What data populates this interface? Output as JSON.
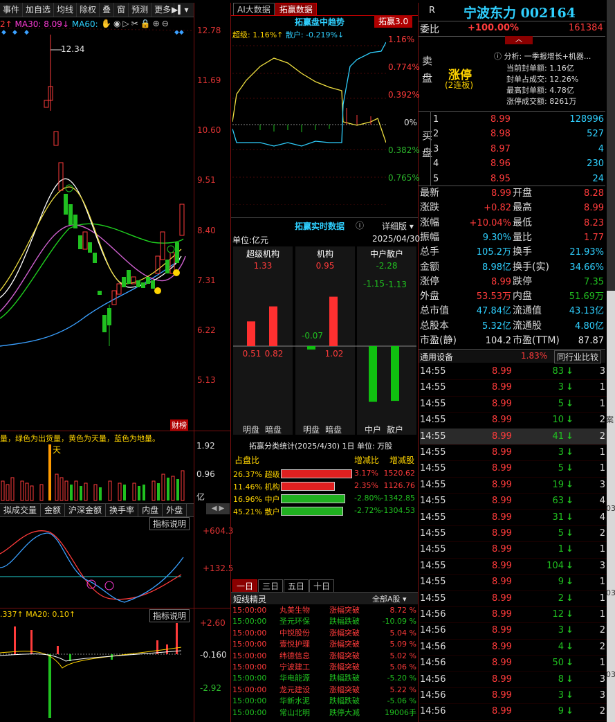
{
  "toolbar": {
    "items": [
      "事件",
      "加自选",
      "均线",
      "除权",
      "叠",
      "窗",
      "预测",
      "更多"
    ]
  },
  "left_chart": {
    "ma_header": {
      "a": "2↑",
      "ma30": "MA30: 8.09↓",
      "ma60": "MA60:"
    },
    "price_axis": [
      "12.78",
      "11.69",
      "10.60",
      "9.51",
      "8.40",
      "7.31",
      "6.22",
      "5.13"
    ],
    "peak_label": "12.34",
    "badge": "财榜",
    "vol_legend": "量，绿色为出货量，黄色为天量，蓝色为地量。",
    "vol_axis": [
      "1.92",
      "0.96",
      "亿"
    ],
    "vol_mark": "天",
    "tabs": [
      "拟成交量",
      "金额",
      "沪深金额",
      "换手率",
      "内盘",
      "外盘"
    ],
    "ind1": {
      "btn": "指标说明",
      "axis": [
        "+604.3",
        "+132.5"
      ]
    },
    "ind2": {
      "header": ".337↑  MA20: 0.10↑",
      "btn": "指标说明",
      "axis": [
        "+2.60",
        "-0.160",
        "-2.92"
      ]
    }
  },
  "mid": {
    "tabs": [
      "AI大数据",
      "拓赢数据"
    ],
    "trend_title": "拓赢盘中趋势",
    "trend_badge": "拓赢3.0",
    "trend_legend": {
      "super": "超级: 1.16%↑",
      "retail": "散户: -0.219%↓"
    },
    "trend_axis": [
      "1.16%",
      "0.774%",
      "0.392%",
      "0%",
      "0.382%",
      "0.765%"
    ],
    "realtime_title": "拓赢实时数据",
    "detail_btn": "详细版",
    "unit": "单位:亿元",
    "date": "2025/04/30",
    "cols": [
      "超级机构",
      "机构",
      "中户散户"
    ],
    "col_totals": [
      "1.33",
      "0.95",
      "-2.28"
    ],
    "bar_labels": [
      "明盘",
      "暗盘",
      "明盘",
      "暗盘",
      "中户",
      "散户"
    ],
    "bar_values": [
      "0.51",
      "0.82",
      "-0.07",
      "1.02",
      "-1.15",
      "-1.13"
    ],
    "classify_title": "拓赢分类统计(2025/4/30) 1日  单位: 万股",
    "classify_head": {
      "pct": "占盘比",
      "chg": "增减比",
      "shares": "增减股"
    },
    "classify_rows": [
      {
        "pct": "26.37% 超级",
        "chg": "3.17%",
        "shares": "1520.62",
        "color": "#e02020"
      },
      {
        "pct": "11.46% 机构",
        "chg": "2.35%",
        "shares": "1126.76",
        "color": "#e02020"
      },
      {
        "pct": "16.96% 中户",
        "chg": "-2.80%",
        "shares": "-1342.85",
        "color": "#20b020"
      },
      {
        "pct": "45.21% 散户",
        "chg": "-2.72%",
        "shares": "-1304.53",
        "color": "#20b020"
      }
    ],
    "period_tabs": [
      "一日",
      "三日",
      "五日",
      "十日"
    ],
    "sprite_title": "短线精灵",
    "sprite_filter": "全部A股",
    "sprite_rows": [
      {
        "t": "15:00:00",
        "name": "丸美生物",
        "type": "涨幅突破",
        "val": "8.72 %",
        "up": true
      },
      {
        "t": "15:00:00",
        "name": "圣元环保",
        "type": "跌幅跌破",
        "val": "-10.09 %",
        "up": false
      },
      {
        "t": "15:00:00",
        "name": "中锐股份",
        "type": "涨幅突破",
        "val": "5.04 %",
        "up": true
      },
      {
        "t": "15:00:00",
        "name": "壹悦护理",
        "type": "涨幅突破",
        "val": "5.09 %",
        "up": true
      },
      {
        "t": "15:00:00",
        "name": "纬德信息",
        "type": "涨幅突破",
        "val": "5.02 %",
        "up": true
      },
      {
        "t": "15:00:00",
        "name": "宁波建工",
        "type": "涨幅突破",
        "val": "5.06 %",
        "up": true
      },
      {
        "t": "15:00:00",
        "name": "华电能源",
        "type": "跌幅跌破",
        "val": "-5.20 %",
        "up": false
      },
      {
        "t": "15:00:00",
        "name": "龙元建设",
        "type": "涨幅突破",
        "val": "5.22 %",
        "up": true
      },
      {
        "t": "15:00:00",
        "name": "华新水泥",
        "type": "跌幅跌破",
        "val": "-5.06 %",
        "up": false
      },
      {
        "t": "15:00:00",
        "name": "常山北明",
        "type": "跌停大减",
        "val": "19006手",
        "up": false
      }
    ]
  },
  "right": {
    "r_mark": "R",
    "stock_title": "宁波东力  002164",
    "weibi_label": "委比",
    "weibi_pct": "+100.00%",
    "weibi_val": "161384",
    "sell_label": "卖盘",
    "buy_label": "买盘",
    "limit_up": "涨停",
    "limit_sub": "(2连板)",
    "analysis": "分析: 一季报增长+机器...",
    "seal_info": [
      "当前封单额: 1.16亿",
      "封单占成交: 12.26%",
      "最高封单额: 4.78亿",
      "涨停成交额: 8261万"
    ],
    "bids": [
      {
        "n": "1",
        "p": "8.99",
        "v": "128996"
      },
      {
        "n": "2",
        "p": "8.98",
        "v": "527"
      },
      {
        "n": "3",
        "p": "8.97",
        "v": "4"
      },
      {
        "n": "4",
        "p": "8.96",
        "v": "230"
      },
      {
        "n": "5",
        "p": "8.95",
        "v": "24"
      }
    ],
    "stats": [
      {
        "l1": "最新",
        "v1": "8.99",
        "c1": "red",
        "l2": "开盘",
        "v2": "8.28",
        "c2": "red"
      },
      {
        "l1": "涨跌",
        "v1": "+0.82",
        "c1": "red",
        "l2": "最高",
        "v2": "8.99",
        "c2": "red"
      },
      {
        "l1": "涨幅",
        "v1": "+10.04%",
        "c1": "red",
        "l2": "最低",
        "v2": "8.23",
        "c2": "red"
      },
      {
        "l1": "振幅",
        "v1": "9.30%",
        "c1": "cyn",
        "l2": "量比",
        "v2": "1.77",
        "c2": "red"
      },
      {
        "l1": "总手",
        "v1": "105.2万",
        "c1": "cyn",
        "l2": "换手",
        "v2": "21.93%",
        "c2": "cyn"
      },
      {
        "l1": "金额",
        "v1": "8.98亿",
        "c1": "cyn",
        "l2": "换手(实)",
        "v2": "34.66%",
        "c2": "cyn"
      },
      {
        "l1": "涨停",
        "v1": "8.99",
        "c1": "red",
        "l2": "跌停",
        "v2": "7.35",
        "c2": "grn"
      },
      {
        "l1": "外盘",
        "v1": "53.53万",
        "c1": "red",
        "l2": "内盘",
        "v2": "51.69万",
        "c2": "grn"
      },
      {
        "l1": "总市值",
        "v1": "47.84亿",
        "c1": "cyn",
        "l2": "流通值",
        "v2": "43.13亿",
        "c2": "cyn"
      },
      {
        "l1": "总股本",
        "v1": "5.32亿",
        "c1": "cyn",
        "l2": "流通股",
        "v2": "4.80亿",
        "c2": "cyn"
      },
      {
        "l1": "市盈(静)",
        "v1": "104.2",
        "c1": "wht",
        "l2": "市盈(TTM)",
        "v2": "87.87",
        "c2": "wht"
      }
    ],
    "industry": {
      "name": "通用设备",
      "pct": "1.83%",
      "btn": "同行业比较"
    },
    "ticks": [
      {
        "t": "14:55",
        "p": "8.99",
        "v": "83",
        "s": "3"
      },
      {
        "t": "14:55",
        "p": "8.99",
        "v": "3",
        "s": "1"
      },
      {
        "t": "14:55",
        "p": "8.99",
        "v": "5",
        "s": "1"
      },
      {
        "t": "14:55",
        "p": "8.99",
        "v": "10",
        "s": "2"
      },
      {
        "t": "14:55",
        "p": "8.99",
        "v": "41",
        "s": "2"
      },
      {
        "t": "14:55",
        "p": "8.99",
        "v": "3",
        "s": "1"
      },
      {
        "t": "14:55",
        "p": "8.99",
        "v": "5",
        "s": "1"
      },
      {
        "t": "14:55",
        "p": "8.99",
        "v": "19",
        "s": "3"
      },
      {
        "t": "14:55",
        "p": "8.99",
        "v": "63",
        "s": "4"
      },
      {
        "t": "14:55",
        "p": "8.99",
        "v": "31",
        "s": "4"
      },
      {
        "t": "14:55",
        "p": "8.99",
        "v": "5",
        "s": "2"
      },
      {
        "t": "14:55",
        "p": "8.99",
        "v": "1",
        "s": "1"
      },
      {
        "t": "14:55",
        "p": "8.99",
        "v": "104",
        "s": "3"
      },
      {
        "t": "14:55",
        "p": "8.99",
        "v": "9",
        "s": "1"
      },
      {
        "t": "14:55",
        "p": "8.99",
        "v": "2",
        "s": "1"
      },
      {
        "t": "14:56",
        "p": "8.99",
        "v": "12",
        "s": "1"
      },
      {
        "t": "14:56",
        "p": "8.99",
        "v": "3",
        "s": "2"
      },
      {
        "t": "14:56",
        "p": "8.99",
        "v": "4",
        "s": "2"
      },
      {
        "t": "14:56",
        "p": "8.99",
        "v": "50",
        "s": "1"
      },
      {
        "t": "14:56",
        "p": "8.99",
        "v": "8",
        "s": "3"
      },
      {
        "t": "14:56",
        "p": "8.99",
        "v": "3",
        "s": "3"
      },
      {
        "t": "14:56",
        "p": "8.99",
        "v": "9",
        "s": "2"
      }
    ]
  },
  "edge": {
    "texts": [
      "案",
      "03'",
      "03'",
      "03'"
    ]
  }
}
